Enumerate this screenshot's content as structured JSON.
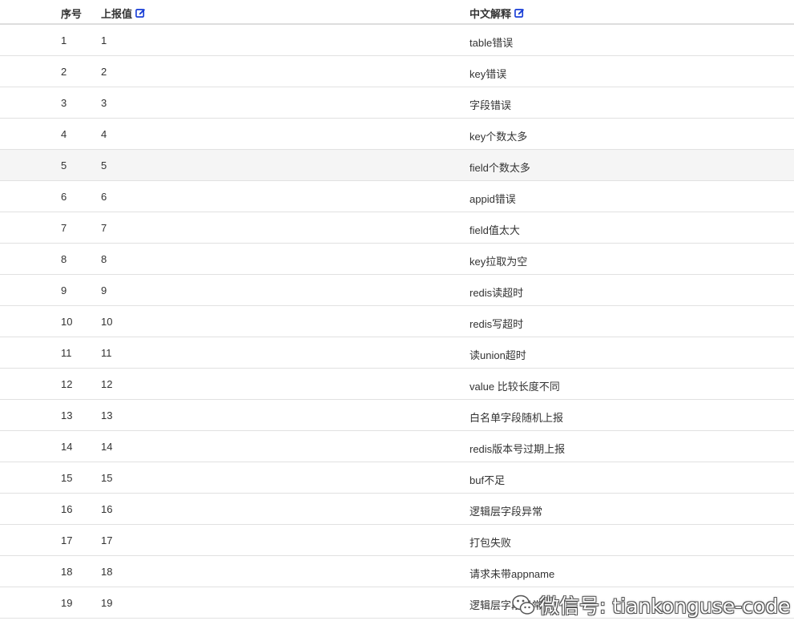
{
  "header": {
    "col_index": "序号",
    "col_value": "上报值",
    "col_desc": "中文解释"
  },
  "rows": [
    {
      "index": "1",
      "value": "1",
      "desc": "table错误"
    },
    {
      "index": "2",
      "value": "2",
      "desc": "key错误"
    },
    {
      "index": "3",
      "value": "3",
      "desc": "字段错误"
    },
    {
      "index": "4",
      "value": "4",
      "desc": "key个数太多"
    },
    {
      "index": "5",
      "value": "5",
      "desc": "field个数太多"
    },
    {
      "index": "6",
      "value": "6",
      "desc": "appid错误"
    },
    {
      "index": "7",
      "value": "7",
      "desc": "field值太大"
    },
    {
      "index": "8",
      "value": "8",
      "desc": "key拉取为空"
    },
    {
      "index": "9",
      "value": "9",
      "desc": "redis读超时"
    },
    {
      "index": "10",
      "value": "10",
      "desc": "redis写超时"
    },
    {
      "index": "11",
      "value": "11",
      "desc": "读union超时"
    },
    {
      "index": "12",
      "value": "12",
      "desc": "value 比较长度不同"
    },
    {
      "index": "13",
      "value": "13",
      "desc": "白名单字段随机上报"
    },
    {
      "index": "14",
      "value": "14",
      "desc": "redis版本号过期上报"
    },
    {
      "index": "15",
      "value": "15",
      "desc": "buf不足"
    },
    {
      "index": "16",
      "value": "16",
      "desc": "逻辑层字段异常"
    },
    {
      "index": "17",
      "value": "17",
      "desc": "打包失败"
    },
    {
      "index": "18",
      "value": "18",
      "desc": "请求未带appname"
    },
    {
      "index": "19",
      "value": "19",
      "desc": "逻辑层字段异常"
    }
  ],
  "hover_row": "5",
  "watermark": {
    "text": "微信号: tiankonguse-code",
    "logo": "wechat-logo-icon"
  },
  "colors": {
    "edit_icon": "#1a3fd6",
    "hover_bg": "#f5f5f5",
    "border": "#e1e1e1"
  }
}
